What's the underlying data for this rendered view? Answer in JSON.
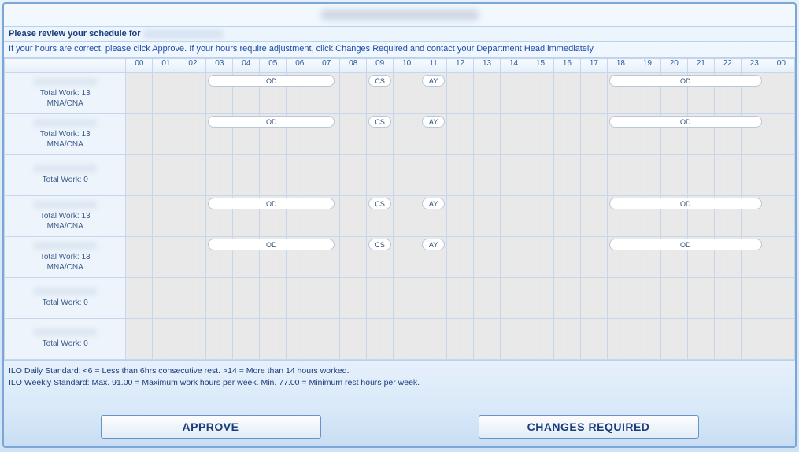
{
  "header": {
    "review_label": "Please review your schedule for",
    "instructions": "If your hours are correct, please click Approve. If your hours require adjustment, click Changes Required and contact your Department Head immediately."
  },
  "hours": [
    "00",
    "01",
    "02",
    "03",
    "04",
    "05",
    "06",
    "07",
    "08",
    "09",
    "10",
    "11",
    "12",
    "13",
    "14",
    "15",
    "16",
    "17",
    "18",
    "19",
    "20",
    "21",
    "22",
    "23",
    "00"
  ],
  "highlight_hour_index": 15,
  "rows": [
    {
      "total_label": "Total Work: 13",
      "sub_label": "MNA/CNA",
      "bands": [
        {
          "start": 3,
          "end": 8,
          "label": "OD"
        },
        {
          "start": 9,
          "end": 10,
          "label": "CS"
        },
        {
          "start": 11,
          "end": 12,
          "label": "AY"
        },
        {
          "start": 18,
          "end": 24,
          "label": "OD"
        }
      ]
    },
    {
      "total_label": "Total Work: 13",
      "sub_label": "MNA/CNA",
      "bands": [
        {
          "start": 3,
          "end": 8,
          "label": "OD"
        },
        {
          "start": 9,
          "end": 10,
          "label": "CS"
        },
        {
          "start": 11,
          "end": 12,
          "label": "AY"
        },
        {
          "start": 18,
          "end": 24,
          "label": "OD"
        }
      ]
    },
    {
      "total_label": "Total Work: 0",
      "sub_label": "",
      "bands": []
    },
    {
      "total_label": "Total Work: 13",
      "sub_label": "MNA/CNA",
      "bands": [
        {
          "start": 3,
          "end": 8,
          "label": "OD"
        },
        {
          "start": 9,
          "end": 10,
          "label": "CS"
        },
        {
          "start": 11,
          "end": 12,
          "label": "AY"
        },
        {
          "start": 18,
          "end": 24,
          "label": "OD"
        }
      ]
    },
    {
      "total_label": "Total Work: 13",
      "sub_label": "MNA/CNA",
      "bands": [
        {
          "start": 3,
          "end": 8,
          "label": "OD"
        },
        {
          "start": 9,
          "end": 10,
          "label": "CS"
        },
        {
          "start": 11,
          "end": 12,
          "label": "AY"
        },
        {
          "start": 18,
          "end": 24,
          "label": "OD"
        }
      ]
    },
    {
      "total_label": "Total Work: 0",
      "sub_label": "",
      "bands": []
    },
    {
      "total_label": "Total Work: 0",
      "sub_label": "",
      "bands": []
    }
  ],
  "footer": {
    "ilo_daily": "ILO Daily Standard: <6 = Less than 6hrs consecutive rest. >14 = More than 14 hours worked.",
    "ilo_weekly": "ILO Weekly Standard: Max. 91.00 = Maximum work hours per week. Min. 77.00 = Minimum rest hours per week."
  },
  "buttons": {
    "approve": "APPROVE",
    "changes": "CHANGES REQUIRED"
  }
}
